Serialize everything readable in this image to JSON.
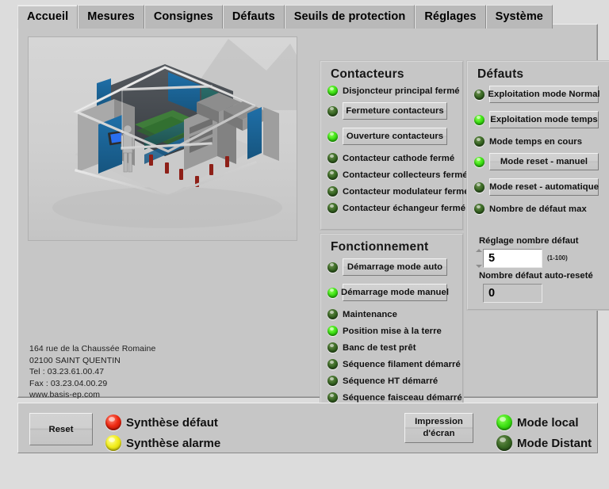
{
  "tabs": [
    {
      "label": "Accueil",
      "active": true
    },
    {
      "label": "Mesures",
      "active": false
    },
    {
      "label": "Consignes",
      "active": false
    },
    {
      "label": "Défauts",
      "active": false
    },
    {
      "label": "Seuils de protection",
      "active": false
    },
    {
      "label": "Réglages",
      "active": false
    },
    {
      "label": "Système",
      "active": false
    }
  ],
  "illustration": {
    "name": "3d-render-test-bench-cabinet",
    "alt": "Rendu 3D d'un banc de test avec armoires électriques et opérateur"
  },
  "address": {
    "line1": "164 rue de la Chaussée Romaine",
    "line2": "02100 SAINT QUENTIN",
    "line3": "Tel : 03.23.61.00.47",
    "line4": "Fax : 03.23.04.00.29",
    "line5": "www.basis-ep.com"
  },
  "contacteurs": {
    "title": "Contacteurs",
    "rows": [
      {
        "kind": "indicator",
        "state": "on",
        "label": "Disjoncteur principal fermé"
      },
      {
        "kind": "button",
        "state": "off",
        "label": "Fermeture contacteurs"
      },
      {
        "kind": "button",
        "state": "on",
        "label": "Ouverture contacteurs"
      },
      {
        "kind": "indicator",
        "state": "off",
        "label": "Contacteur cathode fermé"
      },
      {
        "kind": "indicator",
        "state": "off",
        "label": "Contacteur collecteurs fermé"
      },
      {
        "kind": "indicator",
        "state": "off",
        "label": "Contacteur modulateur fermé"
      },
      {
        "kind": "indicator",
        "state": "off",
        "label": "Contacteur échangeur fermé"
      }
    ]
  },
  "fonctionnement": {
    "title": "Fonctionnement",
    "rows": [
      {
        "kind": "button",
        "state": "off",
        "label": "Démarrage mode auto"
      },
      {
        "kind": "button",
        "state": "on",
        "label": "Démarrage mode manuel"
      },
      {
        "kind": "indicator",
        "state": "off",
        "label": "Maintenance"
      },
      {
        "kind": "indicator",
        "state": "on",
        "label": "Position mise à la terre"
      },
      {
        "kind": "indicator",
        "state": "off",
        "label": "Banc de test prêt"
      },
      {
        "kind": "indicator",
        "state": "off",
        "label": "Séquence filament démarré"
      },
      {
        "kind": "indicator",
        "state": "off",
        "label": "Séquence HT démarré"
      },
      {
        "kind": "indicator",
        "state": "off",
        "label": "Séquence faisceau démarré"
      }
    ]
  },
  "defauts": {
    "title": "Défauts",
    "rows": [
      {
        "kind": "button",
        "state": "off",
        "label": "Exploitation mode Normal"
      },
      {
        "kind": "button",
        "state": "on",
        "label": "Exploitation mode temps"
      },
      {
        "kind": "indicator",
        "state": "off",
        "label": "Mode temps en cours"
      },
      {
        "kind": "button",
        "state": "on",
        "label": "Mode reset - manuel"
      },
      {
        "kind": "button",
        "state": "off",
        "label": "Mode reset - automatique"
      },
      {
        "kind": "indicator",
        "state": "off",
        "label": "Nombre de défaut max"
      }
    ],
    "reglage": {
      "label": "Réglage nombre défaut",
      "value": "5",
      "range_hint": "(1-100)"
    },
    "auto_reset": {
      "label": "Nombre défaut auto-reseté",
      "value": "0"
    }
  },
  "bottom": {
    "reset_label": "Reset",
    "print_line1": "Impression",
    "print_line2": "d'écran",
    "synthese_defaut": {
      "label": "Synthèse défaut",
      "color": "#ee2a12",
      "state": "on"
    },
    "synthese_alarme": {
      "label": "Synthèse alarme",
      "color": "#f2ee1c",
      "state": "on"
    },
    "mode_local": {
      "label": "Mode local",
      "state": "on"
    },
    "mode_distant": {
      "label": "Mode Distant",
      "state": "off"
    }
  },
  "theme": {
    "background": "#dcdcdc",
    "panel": "#c6c6c6",
    "tab_inactive": "#b9b9b9",
    "led_on": "#3fe215",
    "led_off": "#3b6b25"
  }
}
